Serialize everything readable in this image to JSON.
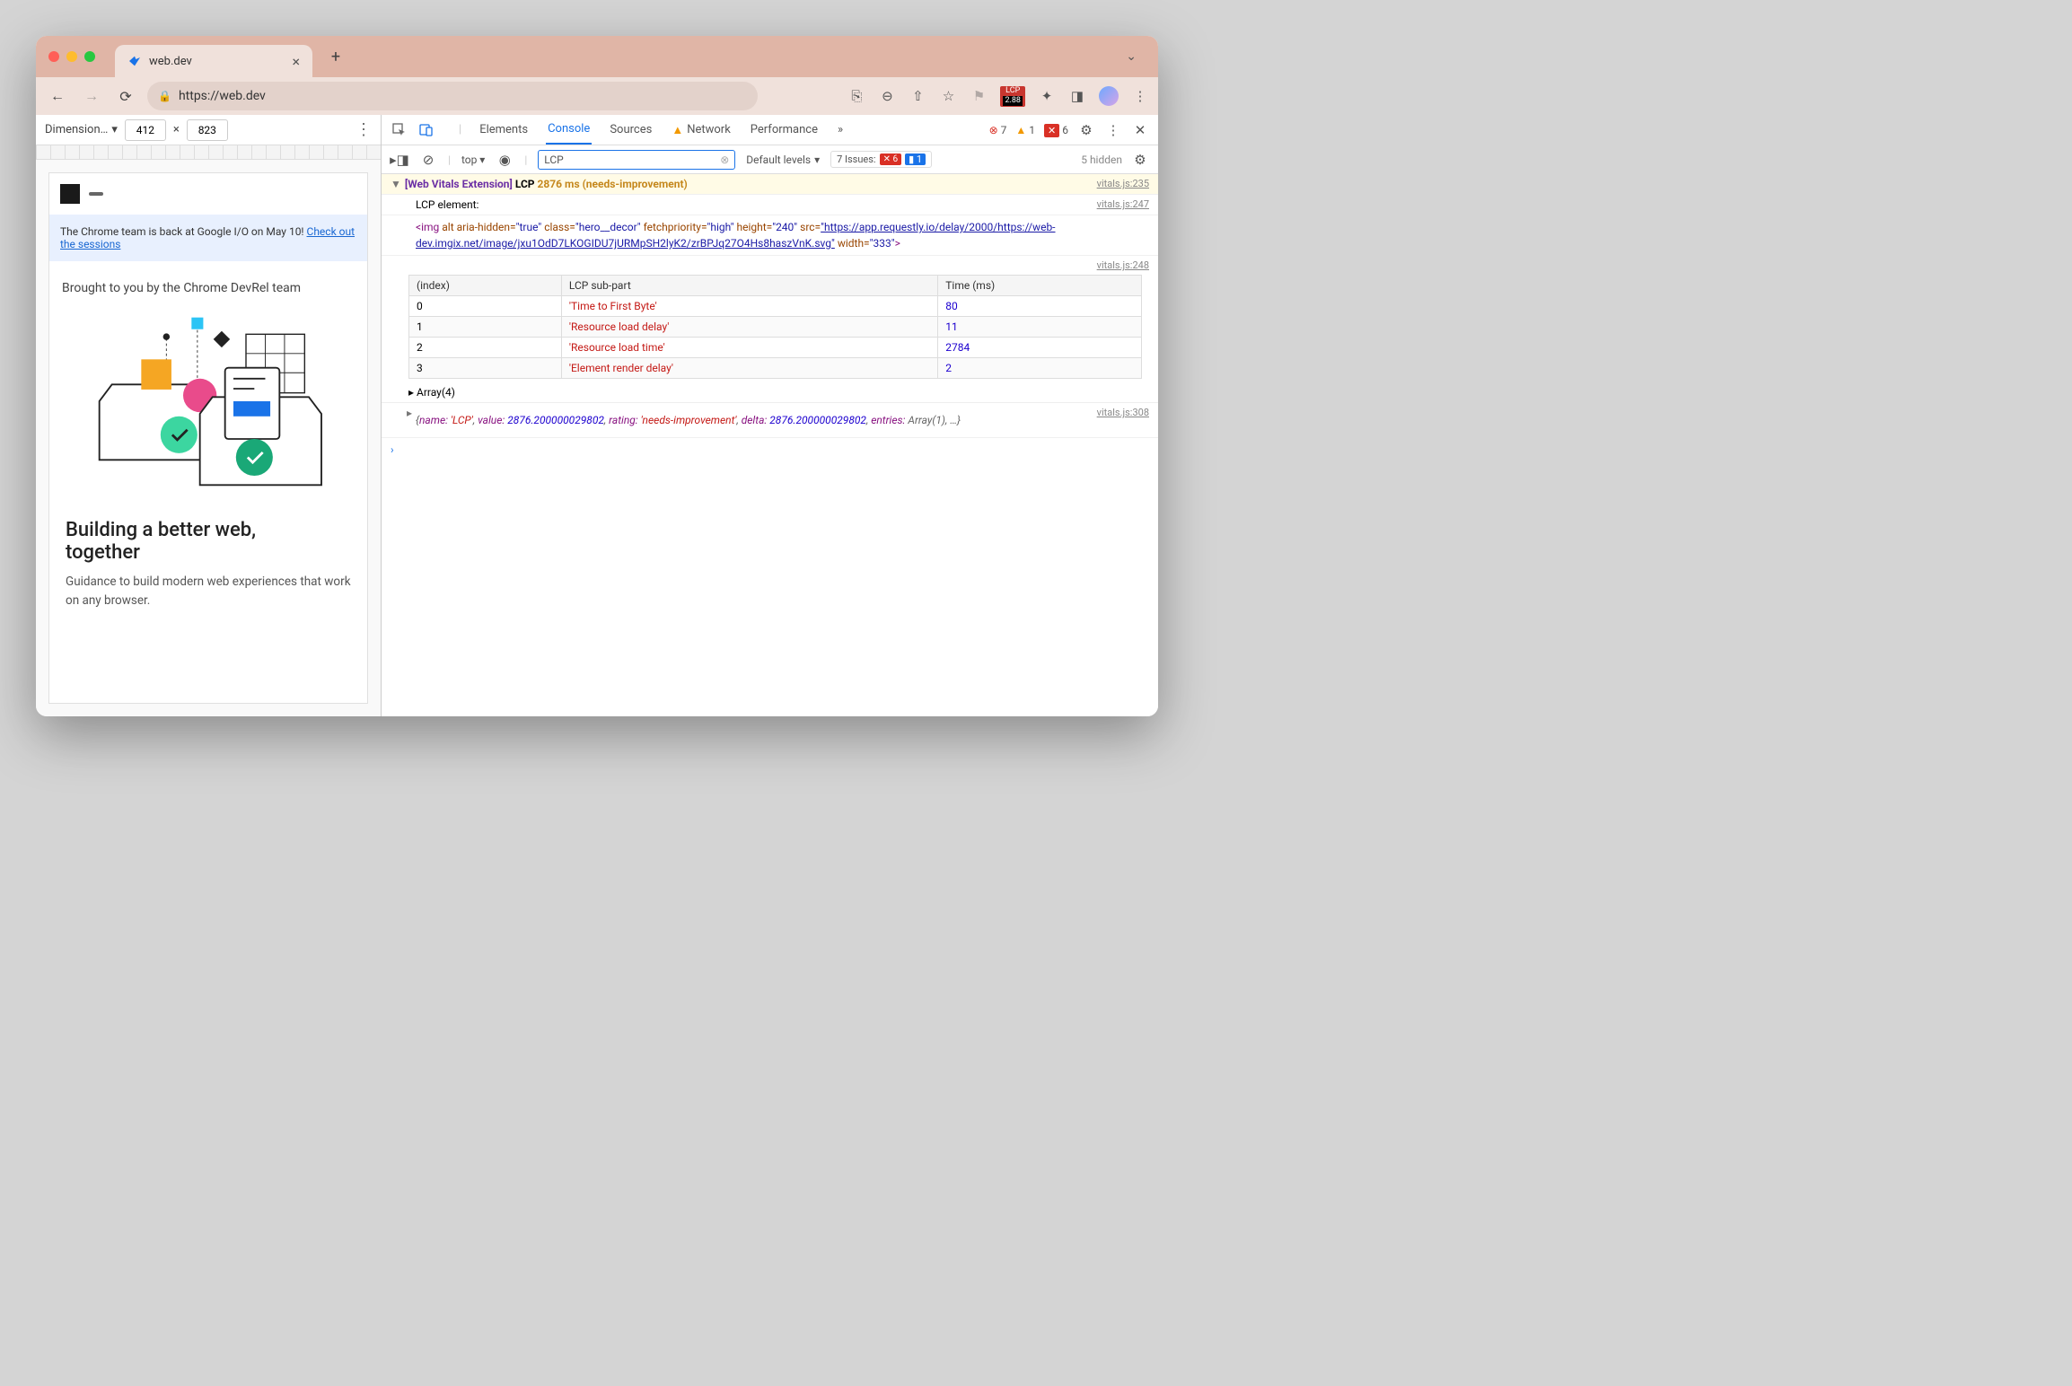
{
  "browser": {
    "tab_title": "web.dev",
    "url": "https://web.dev",
    "lcp_badge_label": "LCP",
    "lcp_badge_score": "2.88"
  },
  "dimensions": {
    "label": "Dimension…",
    "width": "412",
    "x": "×",
    "height": "823"
  },
  "page": {
    "banner_text": "The Chrome team is back at Google I/O on May 10! ",
    "banner_link": "Check out the sessions",
    "intro": "Brought to you by the Chrome DevRel team",
    "hero_title_1": "Building a better web,",
    "hero_title_2": "together",
    "hero_sub": "Guidance to build modern web experiences that work on any browser."
  },
  "devtools": {
    "tabs": {
      "elements": "Elements",
      "console": "Console",
      "sources": "Sources",
      "network": "Network",
      "performance": "Performance"
    },
    "err_count": "7",
    "warn_count": "1",
    "badge_count": "6",
    "filter": {
      "top": "top",
      "input": "LCP",
      "levels": "Default levels",
      "issues_label": "7 Issues:",
      "issues_err": "6",
      "issues_info": "1",
      "hidden": "5 hidden"
    }
  },
  "console": {
    "line1": {
      "prefix": "[Web Vitals Extension]",
      "metric": "LCP",
      "value": "2876 ms",
      "rating": "(needs-improvement)",
      "source": "vitals.js:235"
    },
    "line2": {
      "text": "LCP element:",
      "source": "vitals.js:247"
    },
    "element_html": {
      "tag_open": "<img",
      "attr_alt": "alt",
      "attr_aria": "aria-hidden=",
      "val_aria": "\"true\"",
      "attr_class": "class=",
      "val_class": "\"hero__decor\"",
      "attr_fp": "fetchpriority=",
      "val_fp": "\"high\"",
      "attr_h": "height=",
      "val_h": "\"240\"",
      "attr_src": "src=",
      "link": "\"https://app.requestly.io/delay/2000/https://web-dev.imgix.net/image/jxu1OdD7LKOGIDU7jURMpSH2lyK2/zrBPJq27O4Hs8haszVnK.svg\"",
      "attr_w": "width=",
      "val_w": "\"333\"",
      "tag_close": ">"
    },
    "table": {
      "source": "vitals.js:248",
      "headers": {
        "index": "(index)",
        "subpart": "LCP sub-part",
        "time": "Time (ms)"
      },
      "rows": [
        {
          "i": "0",
          "name": "'Time to First Byte'",
          "ms": "80"
        },
        {
          "i": "1",
          "name": "'Resource load delay'",
          "ms": "11"
        },
        {
          "i": "2",
          "name": "'Resource load time'",
          "ms": "2784"
        },
        {
          "i": "3",
          "name": "'Element render delay'",
          "ms": "2"
        }
      ]
    },
    "array_label": "Array(4)",
    "obj": {
      "source": "vitals.js:308",
      "name_k": "name:",
      "name_v": "'LCP'",
      "value_k": "value:",
      "value_v": "2876.200000029802",
      "rating_k": "rating:",
      "rating_v": "'needs-improvement'",
      "delta_k": "delta:",
      "delta_v": "2876.200000029802",
      "entries_k": "entries:",
      "entries_v": "Array(1)",
      "tail": ", …}"
    }
  },
  "chart_data": {
    "type": "table",
    "title": "LCP sub-part breakdown (ms)",
    "headers": [
      "(index)",
      "LCP sub-part",
      "Time (ms)"
    ],
    "rows": [
      [
        0,
        "Time to First Byte",
        80
      ],
      [
        1,
        "Resource load delay",
        11
      ],
      [
        2,
        "Resource load time",
        2784
      ],
      [
        3,
        "Element render delay",
        2
      ]
    ],
    "total_ms": 2876,
    "rating": "needs-improvement"
  }
}
